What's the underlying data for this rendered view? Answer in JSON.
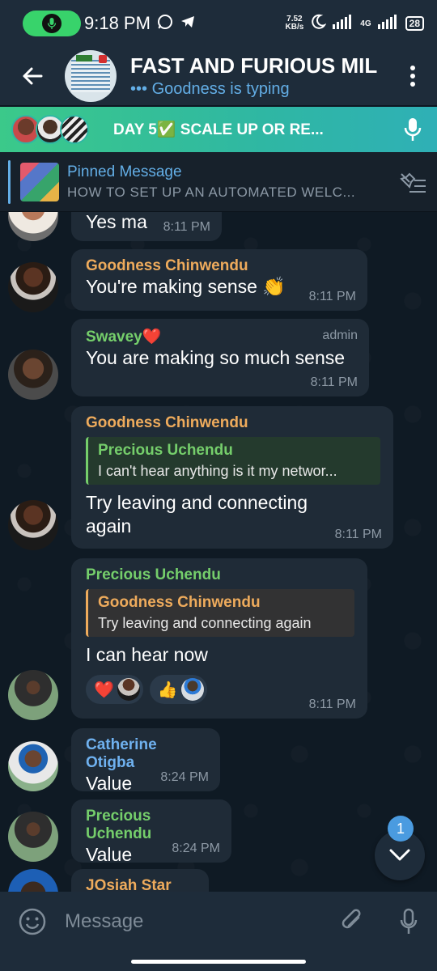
{
  "status_bar": {
    "time": "9:18 PM",
    "speed_value": "7.52",
    "speed_unit": "KB/s",
    "network": "4G",
    "battery": "28"
  },
  "header": {
    "title": "FAST AND FURIOUS MIL",
    "subtitle": "Goodness is typing",
    "typing_dots": "•••"
  },
  "voice_chat": {
    "title": "DAY 5✅ SCALE UP OR RE..."
  },
  "pinned": {
    "label": "Pinned Message",
    "preview": "HOW TO SET UP AN AUTOMATED WELC..."
  },
  "messages": [
    {
      "text": "Yes ma",
      "time": "8:11 PM"
    },
    {
      "sender": "Goodness Chinwendu",
      "text": "You're making sense 👏",
      "time": "8:11 PM"
    },
    {
      "sender": "Swavey❤️",
      "role": "admin",
      "text": "You are making so much sense",
      "time": "8:11 PM"
    },
    {
      "sender": "Goodness Chinwendu",
      "reply_name": "Precious Uchendu",
      "reply_text": "I can't hear anything is it my networ...",
      "text": "Try leaving and connecting again",
      "time": "8:11 PM"
    },
    {
      "sender": "Precious Uchendu",
      "reply_name": "Goodness Chinwendu",
      "reply_text": "Try leaving and connecting again",
      "text": "I can hear now",
      "time": "8:11 PM",
      "reactions": [
        "❤️",
        "👍"
      ]
    },
    {
      "sender": "Catherine Otigba",
      "text": "Value",
      "time": "8:24 PM"
    },
    {
      "sender": "Precious Uchendu",
      "text": "Value",
      "time": "8:24 PM"
    },
    {
      "sender": "JOsiah Star"
    }
  ],
  "scroll_badge": "1",
  "input": {
    "placeholder": "Message"
  },
  "colors": {
    "accent": "#63aee6",
    "bubble": "#1f2b37",
    "background": "#0e1621"
  }
}
